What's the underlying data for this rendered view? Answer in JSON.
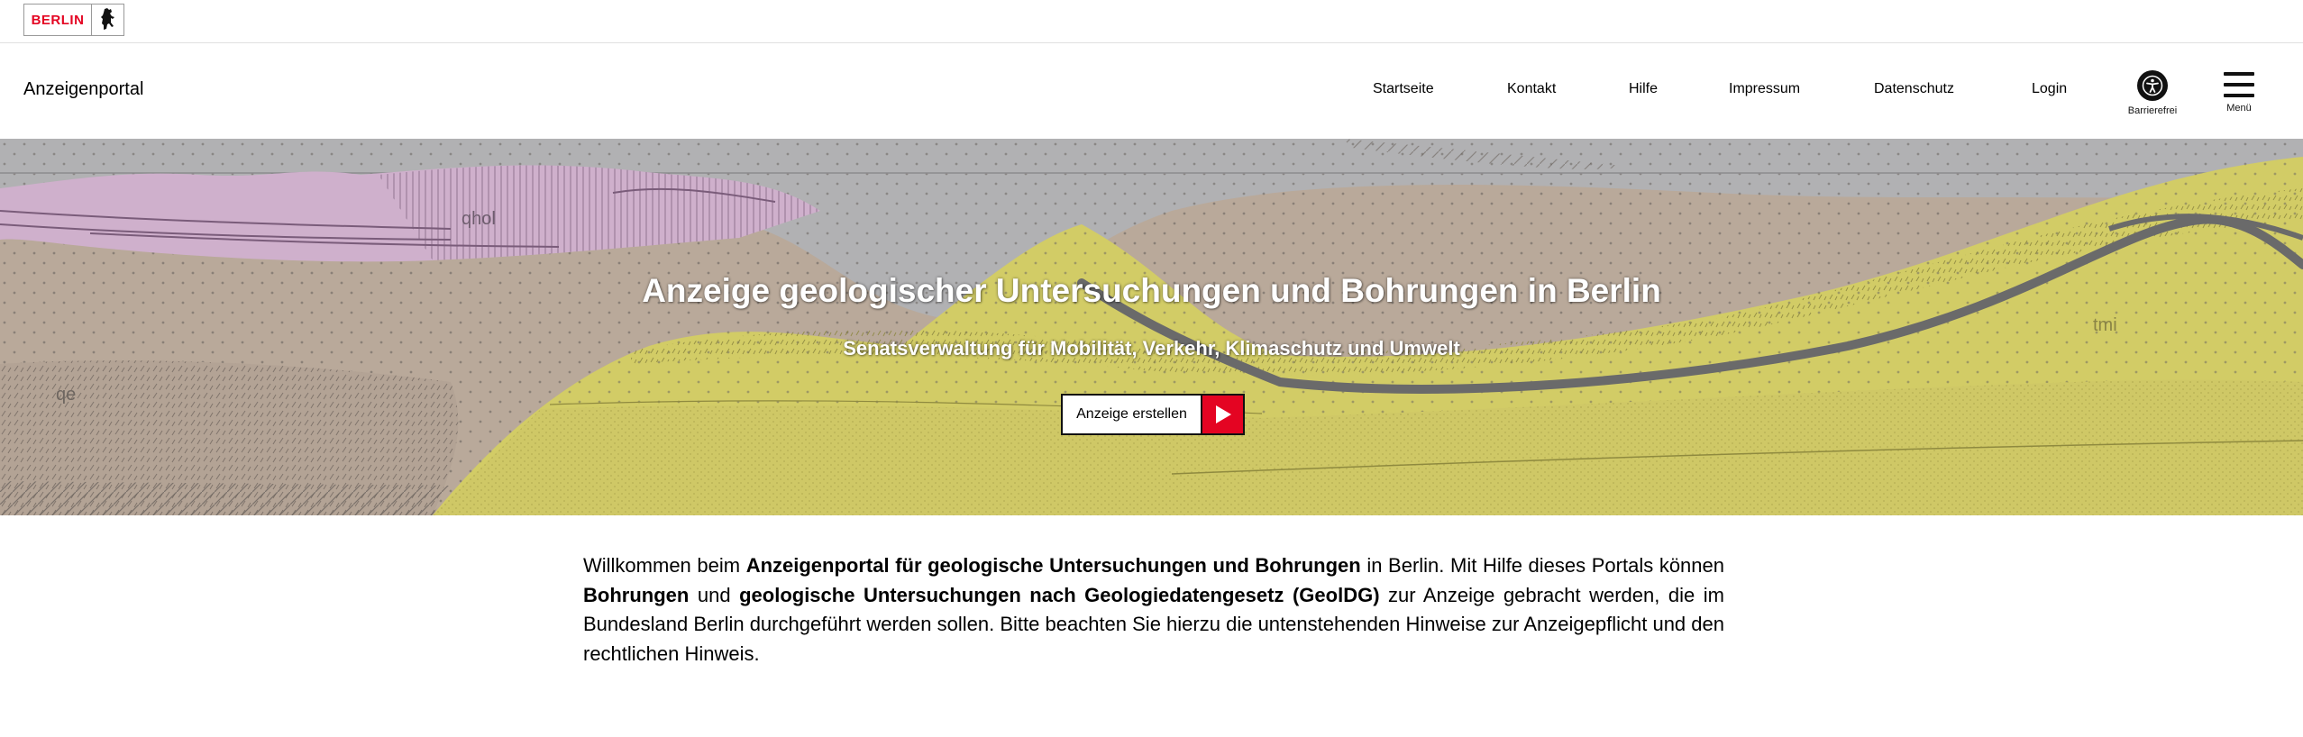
{
  "logo": {
    "text": "BERLIN",
    "icon": "berlin-bear-icon"
  },
  "header": {
    "portal_name": "Anzeigenportal",
    "nav": [
      "Startseite",
      "Kontakt",
      "Hilfe",
      "Impressum",
      "Datenschutz",
      "Login"
    ],
    "accessibility": {
      "label": "Barrierefrei",
      "icon": "accessibility-icon"
    },
    "menu": {
      "label": "Menü",
      "icon": "hamburger-menu-icon"
    }
  },
  "hero": {
    "title": "Anzeige geologischer Untersuchungen und Bohrungen in Berlin",
    "subtitle": "Senatsverwaltung für Mobilität, Verkehr, Klimaschutz und Umwelt",
    "cta_label": "Anzeige erstellen",
    "cta_icon": "play-arrow-icon",
    "map_labels": {
      "qhol": "qhol",
      "qe": "qe",
      "tmi": "tmi"
    },
    "colors": {
      "accent": "#e40422",
      "sand": "#d2cc66",
      "clay": "#b8a898",
      "peat": "#cfb0cc",
      "sky": "#b1b1b3"
    }
  },
  "intro": {
    "p1": "Willkommen beim ",
    "b1": "Anzeigenportal für geologische Untersuchungen und Bohrungen",
    "p2": " in Berlin. Mit Hilfe dieses Portals können ",
    "b2": "Bohrungen",
    "p3": " und ",
    "b3": "geologische Untersuchungen nach Geologiedatengesetz (GeolDG)",
    "p4": " zur Anzeige gebracht werden, die im Bundesland Berlin durchgeführt werden sollen. Bitte beachten Sie hierzu die untenstehenden Hinweise zur Anzeigepflicht und den rechtlichen Hinweis."
  }
}
